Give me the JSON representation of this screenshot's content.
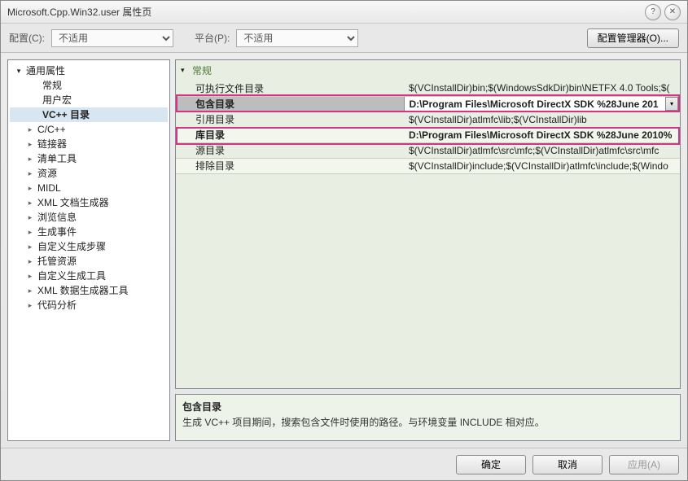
{
  "window": {
    "title": "Microsoft.Cpp.Win32.user 属性页"
  },
  "toolbar": {
    "config_label": "配置(C):",
    "config_value": "不适用",
    "platform_label": "平台(P):",
    "platform_value": "不适用",
    "manager_button": "配置管理器(O)..."
  },
  "tree": {
    "root": "通用属性",
    "general": "常规",
    "user_macros": "用户宏",
    "vc_dirs": "VC++ 目录",
    "items": [
      "C/C++",
      "链接器",
      "清单工具",
      "资源",
      "MIDL",
      "XML 文档生成器",
      "浏览信息",
      "生成事件",
      "自定义生成步骤",
      "托管资源",
      "自定义生成工具",
      "XML 数据生成器工具",
      "代码分析"
    ]
  },
  "grid": {
    "section": "常规",
    "rows": [
      {
        "name": "可执行文件目录",
        "value": "$(VCInstallDir)bin;$(WindowsSdkDir)bin\\NETFX 4.0 Tools;$("
      },
      {
        "name": "包含目录",
        "value": "D:\\Program Files\\Microsoft DirectX SDK %28June 201"
      },
      {
        "name": "引用目录",
        "value": "$(VCInstallDir)atlmfc\\lib;$(VCInstallDir)lib"
      },
      {
        "name": "库目录",
        "value": "D:\\Program Files\\Microsoft DirectX SDK %28June 2010%"
      },
      {
        "name": "源目录",
        "value": "$(VCInstallDir)atlmfc\\src\\mfc;$(VCInstallDir)atlmfc\\src\\mfc"
      },
      {
        "name": "排除目录",
        "value": "$(VCInstallDir)include;$(VCInstallDir)atlmfc\\include;$(Windo"
      }
    ]
  },
  "description": {
    "title": "包含目录",
    "text": "生成 VC++ 项目期间，搜索包含文件时使用的路径。与环境变量 INCLUDE 相对应。"
  },
  "footer": {
    "ok": "确定",
    "cancel": "取消",
    "apply": "应用(A)"
  }
}
